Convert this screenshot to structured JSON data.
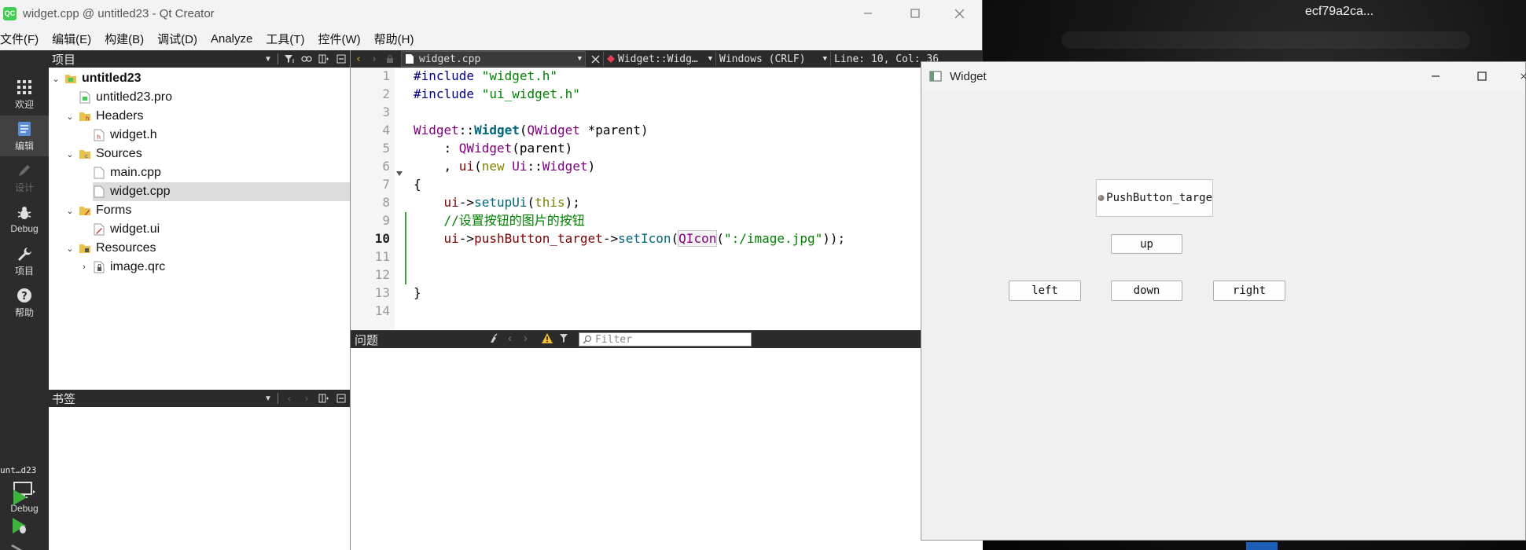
{
  "desktop": {
    "label": "ecf79a2ca..."
  },
  "qtcreator": {
    "title": "widget.cpp @ untitled23 - Qt Creator",
    "app_icon": "QC",
    "menus": [
      "文件(F)",
      "编辑(E)",
      "构建(B)",
      "调试(D)",
      "Analyze",
      "工具(T)",
      "控件(W)",
      "帮助(H)"
    ],
    "modes": [
      {
        "label": "欢迎",
        "icon": "grid-icon"
      },
      {
        "label": "编辑",
        "icon": "document-icon"
      },
      {
        "label": "设计",
        "icon": "pencil-icon"
      },
      {
        "label": "Debug",
        "icon": "bug-icon"
      },
      {
        "label": "项目",
        "icon": "wrench-icon"
      },
      {
        "label": "帮助",
        "icon": "help-icon"
      }
    ],
    "kit": {
      "project_label": "unt…d23",
      "config_label": "Debug"
    },
    "project_panel": {
      "title": "项目",
      "tree": [
        {
          "label": "untitled23",
          "bold": true
        },
        {
          "label": "untitled23.pro"
        },
        {
          "label": "Headers"
        },
        {
          "label": "widget.h"
        },
        {
          "label": "Sources"
        },
        {
          "label": "main.cpp"
        },
        {
          "label": "widget.cpp",
          "selected": true
        },
        {
          "label": "Forms"
        },
        {
          "label": "widget.ui"
        },
        {
          "label": "Resources"
        },
        {
          "label": "image.qrc"
        }
      ]
    },
    "bookmarks_panel": {
      "title": "书签"
    },
    "editor": {
      "file_name": "widget.cpp",
      "symbol": "Widget::Widg…",
      "line_endings": "Windows (CRLF)",
      "position": "Line: 10, Col: 36",
      "line_numbers": [
        "1",
        "2",
        "3",
        "4",
        "5",
        "6",
        "7",
        "8",
        "9",
        "10",
        "11",
        "12",
        "13",
        "14"
      ],
      "current_line": 10
    },
    "issues": {
      "title": "问题",
      "filter_placeholder": "Filter"
    }
  },
  "widget_window": {
    "title": "Widget",
    "buttons": {
      "target": "PushButton_targe",
      "up": "up",
      "left": "left",
      "down": "down",
      "right": "right"
    }
  },
  "colors": {
    "dark_panel": "#2b2b2b",
    "mode_bar": "#2c2c2c",
    "selection": "#dcdcdc",
    "run_green": "#3db33d",
    "qt_green": "#41cd52"
  }
}
